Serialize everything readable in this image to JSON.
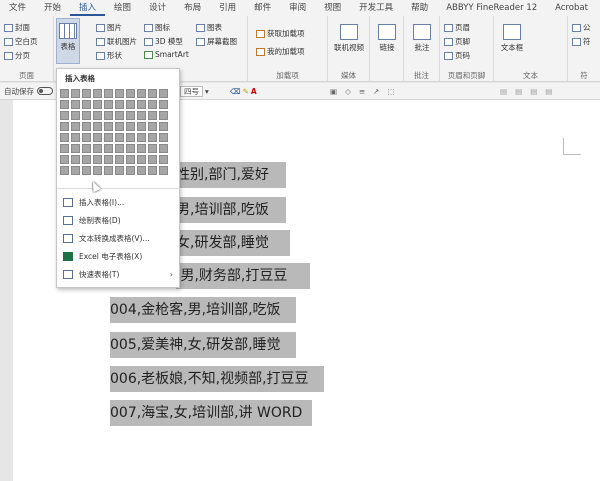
{
  "menu_tabs": [
    "文件",
    "开始",
    "插入",
    "绘图",
    "设计",
    "布局",
    "引用",
    "邮件",
    "审阅",
    "视图",
    "开发工具",
    "帮助",
    "ABBYY FineReader 12",
    "Acrobat"
  ],
  "ribbon": {
    "pages": {
      "cover": "封面",
      "blank": "空白页",
      "break": "分页",
      "label": "页面"
    },
    "table_button": "表格",
    "illustrations": {
      "picture": "图片",
      "online_picture": "联机图片",
      "shapes": "形状",
      "icons": "图标",
      "model3d": "3D 模型",
      "smartart": "SmartArt",
      "chart": "图表",
      "screenshot": "屏幕截图"
    },
    "addins": {
      "get": "获取加载项",
      "mine": "我的加载项",
      "label": "加载项"
    },
    "media": {
      "online_video": "联机视频",
      "label": "媒体"
    },
    "links": {
      "link": "链接"
    },
    "comments": {
      "comment": "批注",
      "label": "批注"
    },
    "header_footer": {
      "header": "页眉",
      "footer": "页脚",
      "page_number": "页码",
      "label": "页眉和页脚"
    },
    "text": {
      "textbox": "文本框",
      "label": "文本"
    },
    "symbols": {
      "formula": "公",
      "symbol": "符",
      "label": "符"
    }
  },
  "fmtbar": {
    "autosave": "自动保存",
    "font_size": "四号"
  },
  "dropdown": {
    "title": "插入表格",
    "items": [
      {
        "label": "插入表格(I)..."
      },
      {
        "label": "绘制表格(D)"
      },
      {
        "label": "文本转换成表格(V)..."
      },
      {
        "label": "Excel 电子表格(X)"
      },
      {
        "label": "快速表格(T)"
      }
    ]
  },
  "document_lines": [
    "性别,部门,爱好",
    "男,培训部,吃饭",
    "女,研发部,睡觉",
    ",男,财务部,打豆豆",
    "004,金枪客,男,培训部,吃饭",
    "005,爱美神,女,研发部,睡觉",
    "006,老板娘,不知,视频部,打豆豆",
    "007,海宝,女,培训部,讲 WORD"
  ]
}
